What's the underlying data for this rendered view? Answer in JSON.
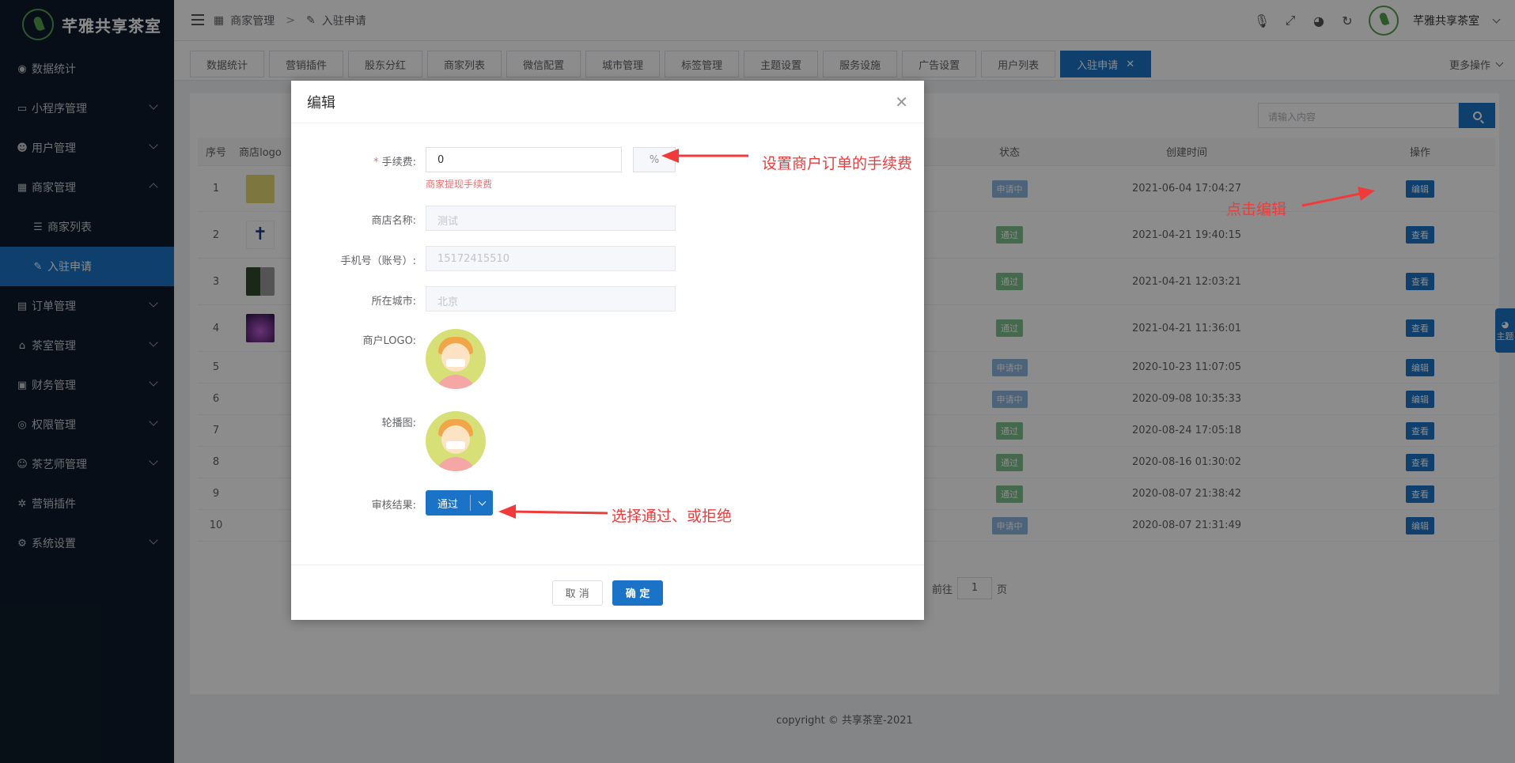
{
  "brand": {
    "title": "芊雅共享茶室"
  },
  "sidebar": {
    "items": [
      {
        "label": "数据统计",
        "icon": "palette-icon"
      },
      {
        "label": "小程序管理",
        "icon": "laptop-icon"
      },
      {
        "label": "用户管理",
        "icon": "users-icon"
      },
      {
        "label": "商家管理",
        "icon": "building-icon"
      },
      {
        "label": "商家列表",
        "icon": "list-icon"
      },
      {
        "label": "入驻申请",
        "icon": "edit-icon"
      },
      {
        "label": "订单管理",
        "icon": "clipboard-icon"
      },
      {
        "label": "茶室管理",
        "icon": "home-icon"
      },
      {
        "label": "财务管理",
        "icon": "money-icon"
      },
      {
        "label": "权限管理",
        "icon": "coins-icon"
      },
      {
        "label": "茶艺师管理",
        "icon": "user-icon"
      },
      {
        "label": "营销插件",
        "icon": "gear-icon"
      },
      {
        "label": "系统设置",
        "icon": "cog-icon"
      }
    ]
  },
  "header": {
    "breadcrumb": [
      "商家管理",
      ">",
      "入驻申请"
    ],
    "username": "芊雅共享茶室"
  },
  "tabs": [
    "数据统计",
    "营销插件",
    "股东分红",
    "商家列表",
    "微信配置",
    "城市管理",
    "标签管理",
    "主题设置",
    "服务设施",
    "广告设置",
    "用户列表",
    "入驻申请"
  ],
  "more_ops": "更多操作",
  "search": {
    "placeholder": "请输入内容"
  },
  "table": {
    "headers": {
      "idx": "序号",
      "logo": "商店logo",
      "status": "状态",
      "time": "创建时间",
      "op": "操作"
    },
    "rows": [
      {
        "idx": "1",
        "status": "申请中",
        "time": "2021-06-04 17:04:27",
        "op": "编辑"
      },
      {
        "idx": "2",
        "status": "通过",
        "time": "2021-04-21 19:40:15",
        "op": "查看"
      },
      {
        "idx": "3",
        "status": "通过",
        "time": "2021-04-21 12:03:21",
        "op": "查看"
      },
      {
        "idx": "4",
        "status": "通过",
        "time": "2021-04-21 11:36:01",
        "op": "查看"
      },
      {
        "idx": "5",
        "status": "申请中",
        "time": "2020-10-23 11:07:05",
        "op": "编辑"
      },
      {
        "idx": "6",
        "status": "申请中",
        "time": "2020-09-08 10:35:33",
        "op": "编辑"
      },
      {
        "idx": "7",
        "status": "通过",
        "time": "2020-08-24 17:05:18",
        "op": "查看"
      },
      {
        "idx": "8",
        "status": "通过",
        "time": "2020-08-16 01:30:02",
        "op": "查看"
      },
      {
        "idx": "9",
        "status": "通过",
        "time": "2020-08-07 21:38:42",
        "op": "查看"
      },
      {
        "idx": "10",
        "status": "申请中",
        "time": "2020-08-07 21:31:49",
        "op": "编辑"
      }
    ]
  },
  "pager": {
    "goto": "前往",
    "page": "1",
    "unit": "页"
  },
  "footer": "copyright © 共享茶室-2021",
  "theme_float": "主题",
  "modal": {
    "title": "编辑",
    "fee_label": "手续费:",
    "fee_value": "0",
    "fee_suffix": "%",
    "fee_hint": "商家提现手续费",
    "shop_label": "商店名称:",
    "shop_value": "测试",
    "phone_label": "手机号（账号）:",
    "phone_value": "15172415510",
    "city_label": "所在城市:",
    "city_value": "北京",
    "logo_label": "商户LOGO:",
    "carousel_label": "轮播图:",
    "review_label": "审核结果:",
    "review_value": "通过",
    "cancel": "取 消",
    "ok": "确 定"
  },
  "annotations": {
    "fee": "设置商户订单的手续费",
    "edit": "点击编辑",
    "review": "选择通过、或拒绝"
  },
  "colors": {
    "primary": "#1a73c7",
    "sidebar": "#0d1b2a",
    "annotation": "#f23a3a"
  }
}
